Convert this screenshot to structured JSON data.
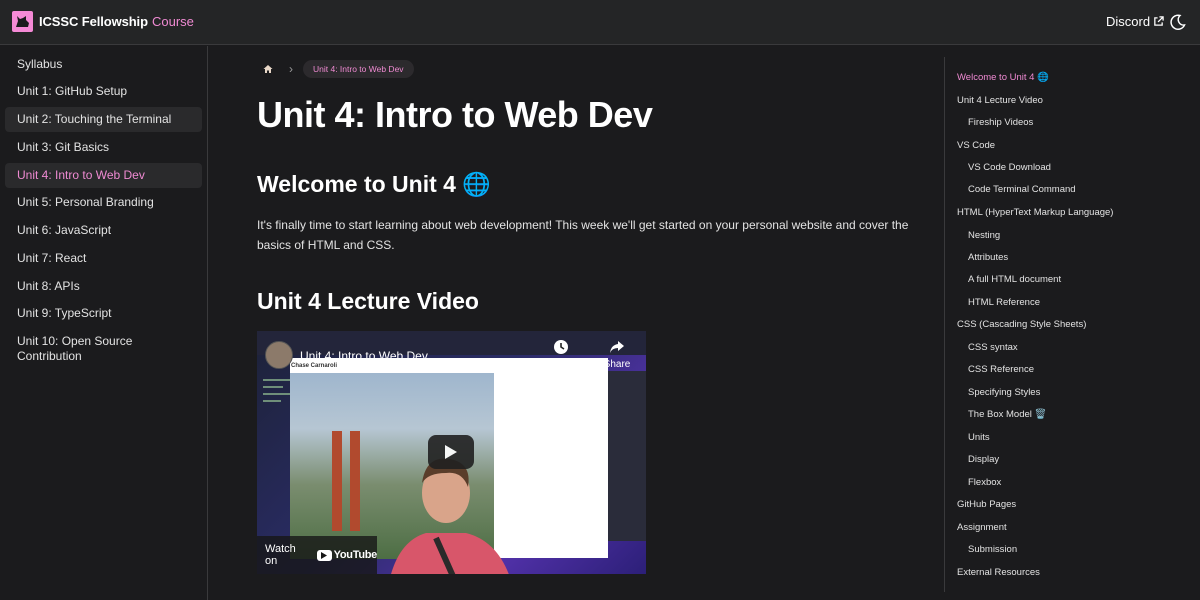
{
  "navbar": {
    "brand": "ICSSC Fellowship",
    "course_link": "Course",
    "discord_link": "Discord",
    "logo_icon": "cat-silhouette-logo",
    "external_icon": "external-link-icon",
    "theme_icon": "moon-icon",
    "accent_color": "#ef8ad2"
  },
  "sidebar": {
    "items": [
      {
        "label": "Syllabus"
      },
      {
        "label": "Unit 1: GitHub Setup"
      },
      {
        "label": "Unit 2: Touching the Terminal"
      },
      {
        "label": "Unit 3: Git Basics"
      },
      {
        "label": "Unit 4: Intro to Web Dev"
      },
      {
        "label": "Unit 5: Personal Branding"
      },
      {
        "label": "Unit 6: JavaScript"
      },
      {
        "label": "Unit 7: React"
      },
      {
        "label": "Unit 8: APIs"
      },
      {
        "label": "Unit 9: TypeScript"
      },
      {
        "label": "Unit 10: Open Source Contribution"
      }
    ]
  },
  "breadcrumb": {
    "home_icon": "home-icon",
    "separator": "›",
    "current": "Unit 4: Intro to Web Dev"
  },
  "main": {
    "title": "Unit 4: Intro to Web Dev",
    "welcome_heading": "Welcome to Unit 4 🌐",
    "intro": "It's finally time to start learning about web development! This week we'll get started on your personal website and cover the basics of HTML and CSS.",
    "lecture_heading": "Unit 4 Lecture Video"
  },
  "video": {
    "title": "Unit 4: Intro to Web Dev",
    "channel": "Chase Carnaroli",
    "watch_later": "Watch later",
    "share": "Share",
    "watch_on": "Watch on",
    "youtube": "YouTube",
    "play_icon": "play-icon",
    "clock_icon": "clock-icon",
    "share_icon": "share-arrow-icon"
  },
  "toc": {
    "items": [
      {
        "label": "Welcome to Unit 4 🌐"
      },
      {
        "label": "Unit 4 Lecture Video"
      },
      {
        "label": "Fireship Videos"
      },
      {
        "label": "VS Code"
      },
      {
        "label": "VS Code Download"
      },
      {
        "label": "Code Terminal Command"
      },
      {
        "label": "HTML (HyperText Markup Language)"
      },
      {
        "label": "Nesting"
      },
      {
        "label": "Attributes"
      },
      {
        "label": "A full HTML document"
      },
      {
        "label": "HTML Reference"
      },
      {
        "label": "CSS (Cascading Style Sheets)"
      },
      {
        "label": "CSS syntax"
      },
      {
        "label": "CSS Reference"
      },
      {
        "label": "Specifying Styles"
      },
      {
        "label": "The Box Model 🗑️"
      },
      {
        "label": "Units"
      },
      {
        "label": "Display"
      },
      {
        "label": "Flexbox"
      },
      {
        "label": "GitHub Pages"
      },
      {
        "label": "Assignment"
      },
      {
        "label": "Submission"
      },
      {
        "label": "External Resources"
      }
    ]
  }
}
